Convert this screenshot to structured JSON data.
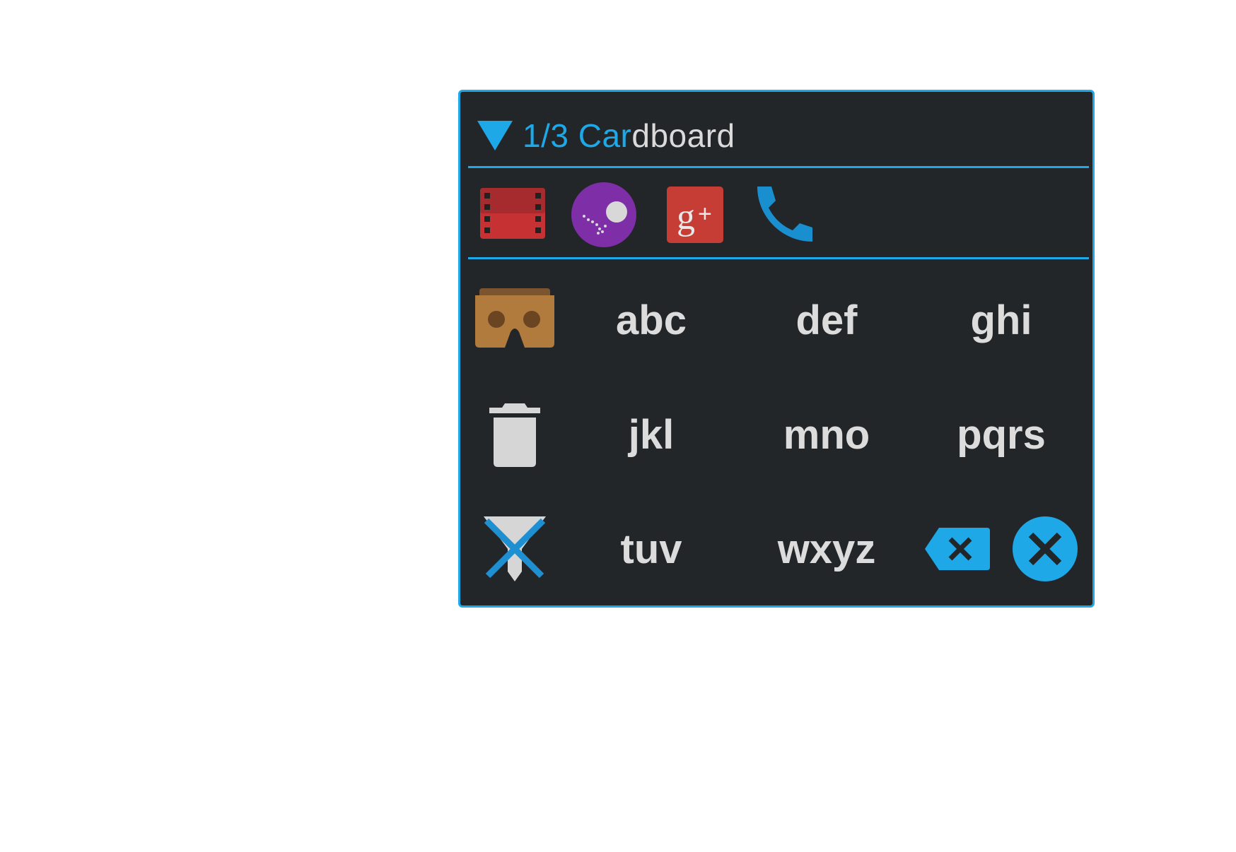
{
  "header": {
    "count": "1/3",
    "query_typed": "Car",
    "query_rest": "dboard"
  },
  "apps": [
    {
      "name": "Play Movies",
      "icon": "film-icon"
    },
    {
      "name": "Kik / Spotlight",
      "icon": "purple-dots-icon"
    },
    {
      "name": "Google+",
      "icon": "google-plus-icon"
    },
    {
      "name": "Phone",
      "icon": "phone-icon"
    }
  ],
  "keypad": {
    "row1": [
      "abc",
      "def",
      "ghi"
    ],
    "row2": [
      "jkl",
      "mno",
      "pqrs"
    ],
    "row3": [
      "tuv",
      "wxyz"
    ]
  },
  "colors": {
    "accent": "#1fa8e8",
    "panel_bg": "#232629",
    "text": "#dcdcdc"
  }
}
